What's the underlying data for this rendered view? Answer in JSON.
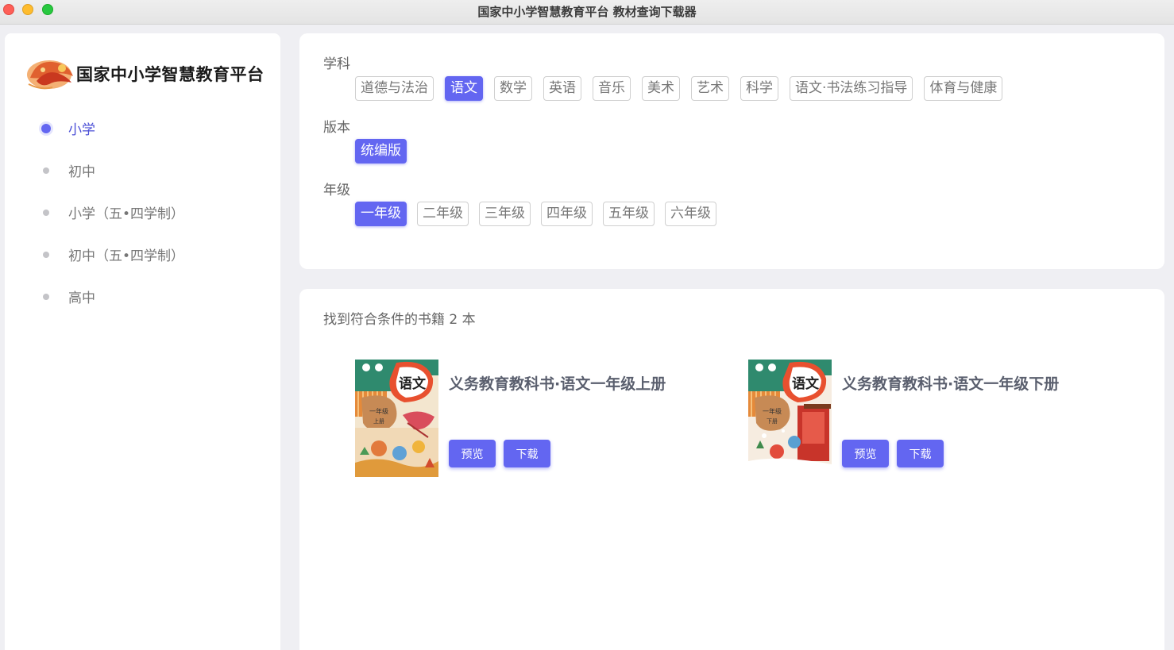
{
  "window": {
    "title": "国家中小学智慧教育平台 教材查询下载器"
  },
  "sidebar": {
    "logo_text": "国家中小学智慧教育平台",
    "items": [
      {
        "label": "小学",
        "active": true
      },
      {
        "label": "初中",
        "active": false
      },
      {
        "label": "小学（五•四学制）",
        "active": false
      },
      {
        "label": "初中（五•四学制）",
        "active": false
      },
      {
        "label": "高中",
        "active": false
      }
    ]
  },
  "filters": {
    "subject": {
      "label": "学科",
      "options": [
        "道德与法治",
        "语文",
        "数学",
        "英语",
        "音乐",
        "美术",
        "艺术",
        "科学",
        "语文·书法练习指导",
        "体育与健康"
      ],
      "selected": "语文"
    },
    "edition": {
      "label": "版本",
      "options": [
        "统编版"
      ],
      "selected": "统编版"
    },
    "grade": {
      "label": "年级",
      "options": [
        "一年级",
        "二年级",
        "三年级",
        "四年级",
        "五年级",
        "六年级"
      ],
      "selected": "一年级"
    }
  },
  "results": {
    "summary": "找到符合条件的书籍 2 本",
    "books": [
      {
        "title": "义务教育教科书·语文一年级上册",
        "preview_label": "预览",
        "download_label": "下载",
        "cover_subject": "语文",
        "cover_grade": "一年级",
        "cover_term": "上册"
      },
      {
        "title": "义务教育教科书·语文一年级下册",
        "preview_label": "预览",
        "download_label": "下载",
        "cover_subject": "语文",
        "cover_grade": "一年级",
        "cover_term": "下册"
      }
    ]
  },
  "colors": {
    "accent": "#6366f1",
    "background": "#efeff3",
    "card": "#ffffff"
  }
}
